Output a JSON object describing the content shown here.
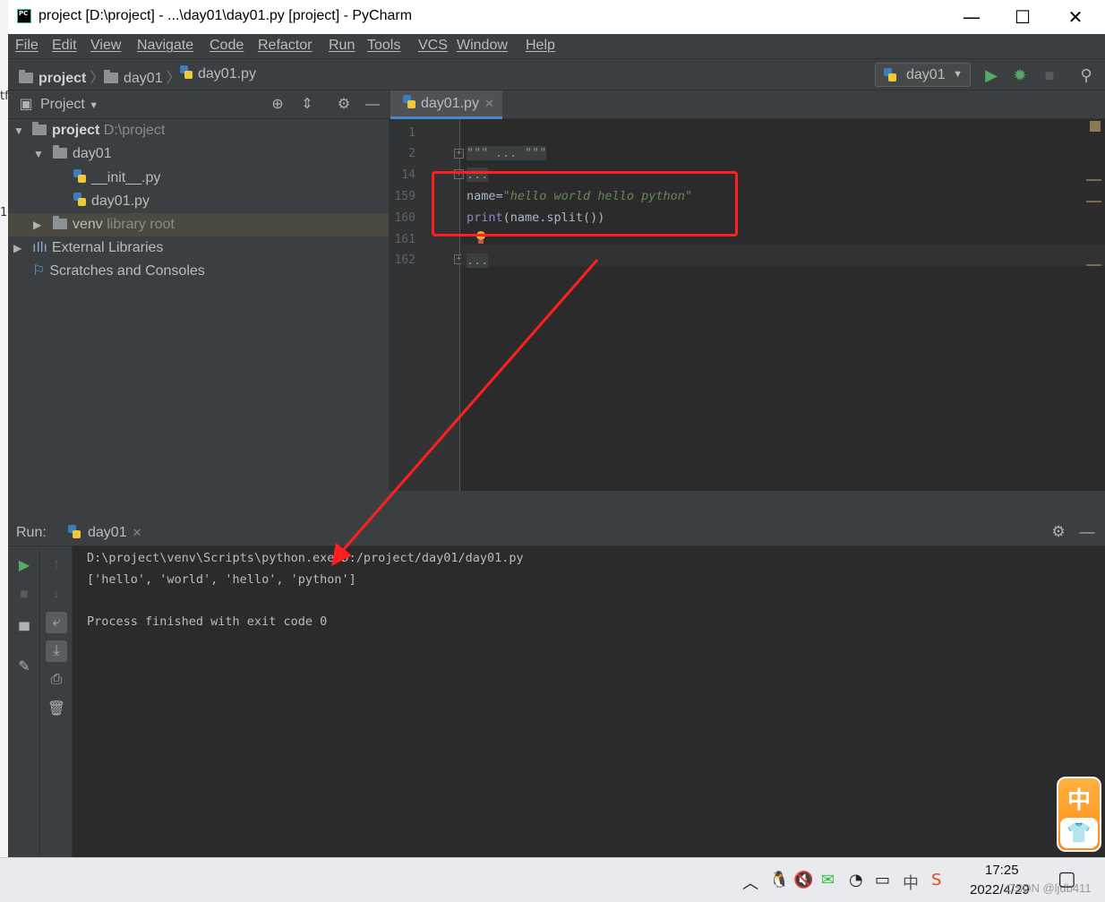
{
  "window": {
    "title": "project [D:\\project] - ...\\day01\\day01.py [project] - PyCharm",
    "app_icon_text": "PC",
    "controls": {
      "minimize": "—",
      "maximize": "☐",
      "close": "✕"
    }
  },
  "menu": {
    "items": [
      "File",
      "Edit",
      "View",
      "Navigate",
      "Code",
      "Refactor",
      "Run",
      "Tools",
      "VCS",
      "Window",
      "Help"
    ]
  },
  "navbar": {
    "breadcrumbs": [
      "project",
      "day01",
      "day01.py"
    ],
    "run_config": "day01"
  },
  "project_panel": {
    "title": "Project",
    "tree": [
      {
        "name": "project",
        "hint": "D:\\project"
      },
      {
        "name": "day01"
      },
      {
        "name": "__init__.py"
      },
      {
        "name": "day01.py"
      },
      {
        "name": "venv",
        "hint": "library root"
      },
      {
        "name": "External Libraries"
      },
      {
        "name": "Scratches and Consoles"
      }
    ]
  },
  "editor": {
    "tab": "day01.py",
    "line_numbers": [
      "1",
      "2",
      "14",
      "159",
      "160",
      "161",
      "162"
    ],
    "folded_docstring": "\"\"\" ... \"\"\"",
    "folded_block": "...",
    "line159": {
      "var": "name",
      "op": "=",
      "string": "\"hello world hello python\""
    },
    "line160": {
      "builtin": "print",
      "rest": "(name.split())"
    },
    "line162": "..."
  },
  "run_panel": {
    "label": "Run:",
    "tab": "day01",
    "console": [
      "D:\\project\\venv\\Scripts\\python.exe D:/project/day01/day01.py",
      "['hello', 'world', 'hello', 'python']",
      "",
      "Process finished with exit code 0"
    ]
  },
  "ime": {
    "label": "中",
    "icon": "shirt-icon"
  },
  "taskbar": {
    "tray_input": "中",
    "time": "17:25",
    "date": "2022/4/29",
    "watermark": "CSDN @ljdb411"
  },
  "colors": {
    "accent": "#4a88c7",
    "annotation": "#ff1f1f",
    "run_green": "#59a869",
    "string_green": "#6a8759"
  }
}
